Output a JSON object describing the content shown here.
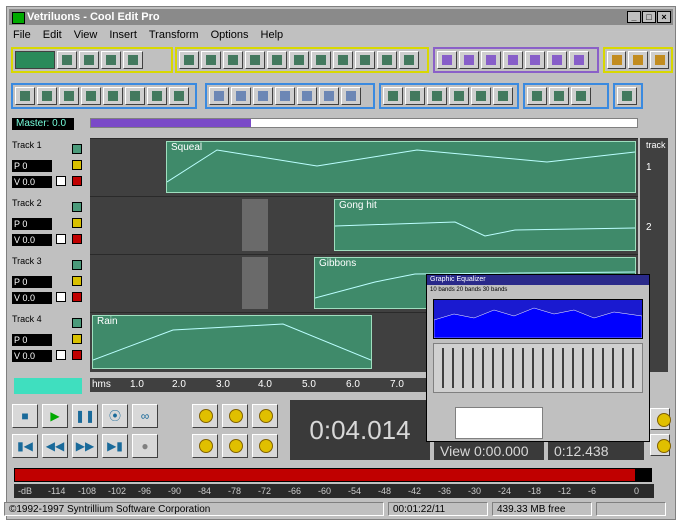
{
  "window": {
    "title": "Vetriluons - Cool Edit Pro",
    "buttons": [
      "_",
      "□",
      "×"
    ]
  },
  "menu": [
    "File",
    "Edit",
    "View",
    "Insert",
    "Transform",
    "Options",
    "Help"
  ],
  "master": {
    "label": "Master: 0.0"
  },
  "tracks": [
    {
      "name": "Track 1",
      "pan": "P 0",
      "vol": "V 0.0",
      "clip_label": "Squeal",
      "right_label": "1"
    },
    {
      "name": "Track 2",
      "pan": "P 0",
      "vol": "V 0.0",
      "clip_label": "Gong hit",
      "right_label": "2"
    },
    {
      "name": "Track 3",
      "pan": "P 0",
      "vol": "V 0.0",
      "clip_label": "Gibbons",
      "right_label": ""
    },
    {
      "name": "Track 4",
      "pan": "P 0",
      "vol": "V 0.0",
      "clip_label": "Rain",
      "right_label": ""
    }
  ],
  "right_header": "track",
  "ruler": [
    "hms",
    "1.0",
    "2.0",
    "3.0",
    "4.0",
    "5.0",
    "6.0",
    "7.0"
  ],
  "transport": {
    "buttons": [
      "■",
      "▶",
      "❚❚",
      "⦿",
      "∞",
      "▮◀",
      "◀◀",
      "▶▶",
      "▶▮",
      "●"
    ]
  },
  "time_display": "0:04.014",
  "selection": {
    "view_start": "View  0:00.000",
    "view_end": "0:12.438"
  },
  "level_scale": [
    "-dB",
    "-114",
    "-108",
    "-102",
    "-96",
    "-90",
    "-84",
    "-78",
    "-72",
    "-66",
    "-60",
    "-54",
    "-48",
    "-42",
    "-36",
    "-30",
    "-24",
    "-18",
    "-12",
    "-6",
    "0"
  ],
  "status": {
    "copyright": "©1992-1997 Syntrillium Software Corporation",
    "time": "00:01:22/11",
    "free": "439.33 MB free"
  },
  "dialog": {
    "title": "Graphic Equalizer",
    "tabs": "10 bands  20 bands  30 bands"
  }
}
